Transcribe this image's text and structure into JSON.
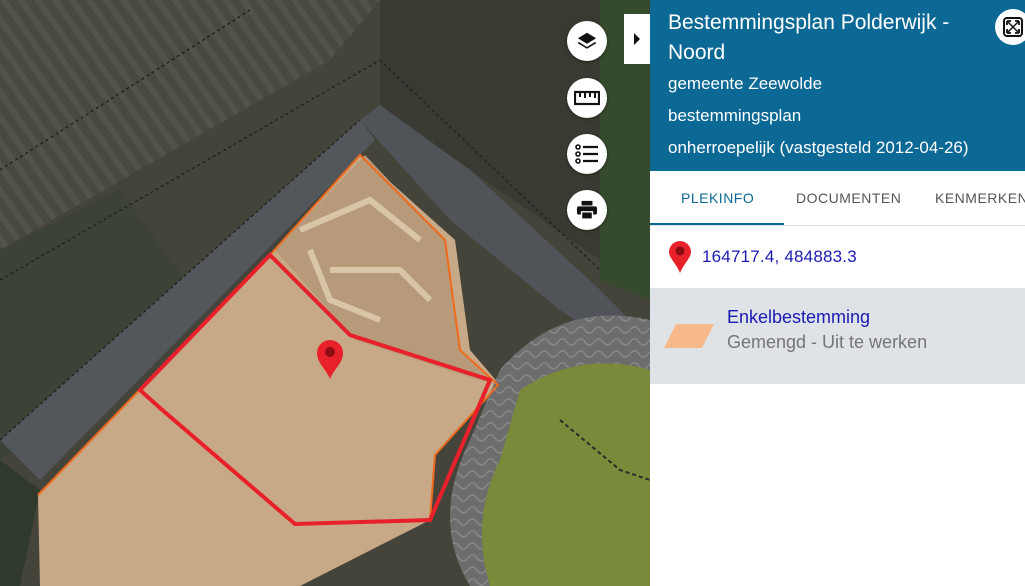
{
  "map": {
    "controls": [
      {
        "name": "layers-icon"
      },
      {
        "name": "ruler-icon"
      },
      {
        "name": "legend-list-icon"
      },
      {
        "name": "print-icon"
      }
    ],
    "plot_outline_color": "#e8202a",
    "boundary_color": "#f06a1e",
    "marker_color": "#e8202a"
  },
  "panel": {
    "title": "Bestemmingsplan Polderwijk - Noord",
    "municipality": "gemeente Zeewolde",
    "type": "bestemmingsplan",
    "status": "onherroepelijk (vastgesteld 2012-04-26)",
    "header_color": "#0c6894",
    "tabs": [
      "PLEKINFO",
      "DOCUMENTEN",
      "KENMERKEN"
    ],
    "active_tab": "PLEKINFO",
    "coordinates": "164717.4, 484883.3",
    "result": {
      "title": "Enkelbestemming",
      "subtitle": "Gemengd - Uit te werken",
      "swatch_color": "#f7b98b"
    }
  }
}
